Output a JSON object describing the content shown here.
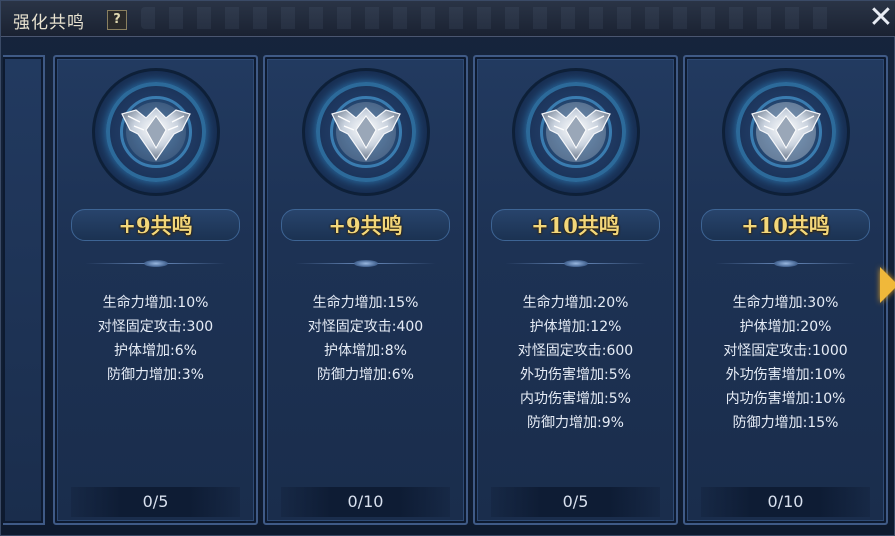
{
  "window": {
    "title": "强化共鸣",
    "help_label": "?",
    "close_label": "✕"
  },
  "cards": [
    {
      "level_label": "+9共鸣",
      "stats": [
        "生命力增加:10%",
        "对怪固定攻击:300",
        "护体增加:6%",
        "防御力增加:3%"
      ],
      "progress": "0/5"
    },
    {
      "level_label": "+9共鸣",
      "stats": [
        "生命力增加:15%",
        "对怪固定攻击:400",
        "护体增加:8%",
        "防御力增加:6%"
      ],
      "progress": "0/10"
    },
    {
      "level_label": "+10共鸣",
      "stats": [
        "生命力增加:20%",
        "护体增加:12%",
        "对怪固定攻击:600",
        "外功伤害增加:5%",
        "内功伤害增加:5%",
        "防御力增加:9%"
      ],
      "progress": "0/5"
    },
    {
      "level_label": "+10共鸣",
      "stats": [
        "生命力增加:30%",
        "护体增加:20%",
        "对怪固定攻击:1000",
        "外功伤害增加:10%",
        "内功伤害增加:10%",
        "防御力增加:15%"
      ],
      "progress": "0/10"
    }
  ],
  "icons": {
    "emblem": "winged-shield-emblem-icon",
    "next": "chevron-right-icon",
    "close": "close-icon",
    "help": "help-icon"
  },
  "colors": {
    "accent_gold": "#f3d77a",
    "stat_text": "#e6ecf6",
    "card_bg": "#1d3254"
  }
}
